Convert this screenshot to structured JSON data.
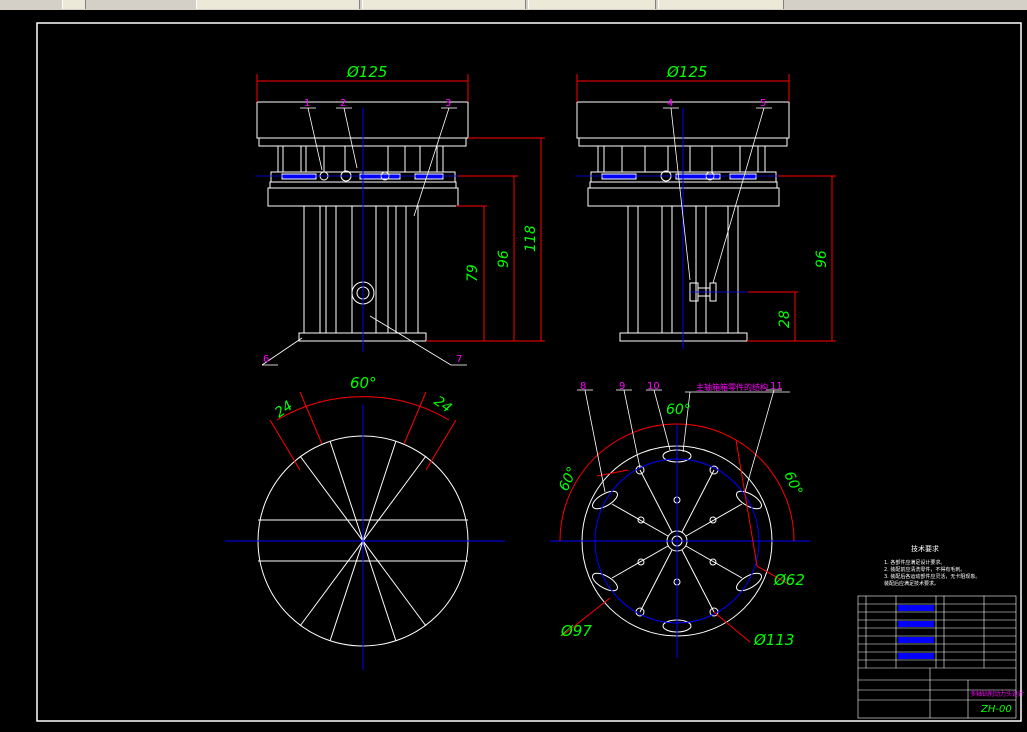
{
  "toolbar": {
    "tabs": [
      "",
      "",
      "",
      "",
      ""
    ]
  },
  "drawing": {
    "colors": {
      "background": "#000000",
      "outline": "#ffffff",
      "dimension": "#ff0000",
      "dimension_text": "#00ff00",
      "centerline": "#0000ff",
      "labels": "#ff00ff",
      "part_fill": "#0000ff"
    },
    "front_view": {
      "width_dim": "Ø125",
      "dims": [
        "79",
        "96",
        "118"
      ],
      "balloons": [
        "1",
        "2",
        "3",
        "6",
        "7"
      ]
    },
    "side_view": {
      "width_dim": "Ø125",
      "dims": [
        "96",
        "28"
      ],
      "balloons": [
        "4",
        "5"
      ]
    },
    "bottom_left_view": {
      "angle": "60°",
      "dim_left": "24",
      "dim_right": "24"
    },
    "bottom_right_view": {
      "balloons": [
        "8",
        "9",
        "10",
        "11"
      ],
      "callout": "主轴箱箱零件的结构",
      "angles": [
        "60°",
        "60°",
        "60°"
      ],
      "dims": [
        "Ø62",
        "Ø97",
        "Ø113"
      ]
    },
    "notes": {
      "title": "技术要求",
      "lines": [
        "1. 各部件应满足设计要求。",
        "2. 装配前应清洗零件，不得有毛刺。",
        "3. 装配后各运动部件应灵活，无卡阻现象。",
        "装配后应满足技术要求。"
      ]
    },
    "title_block": {
      "drawing_no": "ZH-00",
      "title": "多轴钻削动力头设计"
    }
  }
}
